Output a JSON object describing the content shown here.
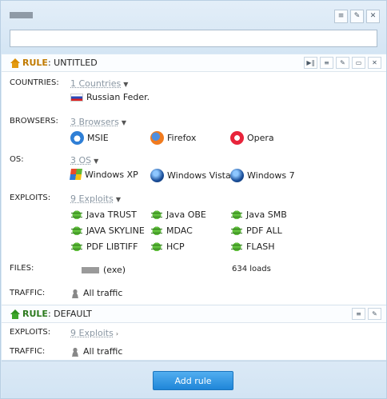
{
  "header": {
    "input_value": "                          "
  },
  "rule1": {
    "rule_word": "RULE",
    "separator": ":",
    "name": "UNTITLED",
    "countries": {
      "label": "COUNTRIES:",
      "dropdown": "1 Countries",
      "items": [
        "Russian Feder."
      ]
    },
    "browsers": {
      "label": "BROWSERS:",
      "dropdown": "3 Browsers",
      "items": [
        "MSIE",
        "Firefox",
        "Opera"
      ]
    },
    "os": {
      "label": "OS:",
      "dropdown": "3 OS",
      "items": [
        "Windows XP",
        "Windows Vista",
        "Windows 7"
      ]
    },
    "exploits": {
      "label": "EXPLOITS:",
      "dropdown": "9 Exploits",
      "items": [
        "Java TRUST",
        "Java OBE",
        "Java SMB",
        "JAVA SKYLINE",
        "MDAC",
        "PDF ALL",
        "PDF LIBTIFF",
        "HCP",
        "FLASH"
      ]
    },
    "files": {
      "label": "FILES:",
      "file_ext": "(exe)",
      "loads": "634 loads"
    },
    "traffic": {
      "label": "TRAFFIC:",
      "value": "All traffic"
    }
  },
  "rule2": {
    "rule_word": "RULE",
    "separator": ":",
    "name": "DEFAULT",
    "exploits": {
      "label": "EXPLOITS:",
      "dropdown": "9 Exploits"
    },
    "traffic": {
      "label": "TRAFFIC:",
      "value": "All traffic"
    }
  },
  "footer": {
    "add_rule_label": "Add rule"
  }
}
